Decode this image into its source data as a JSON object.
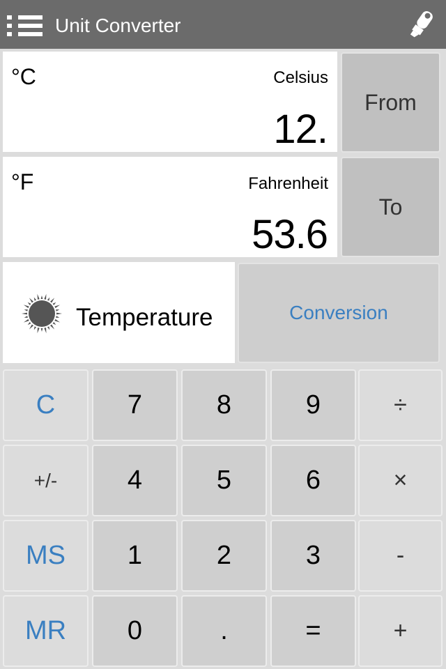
{
  "header": {
    "title": "Unit Converter",
    "menu_icon": "list-menu-icon",
    "action_icon": "marker-pen-icon"
  },
  "from_unit": {
    "symbol": "°C",
    "name": "Celsius",
    "value": "12.",
    "button_label": "From"
  },
  "to_unit": {
    "symbol": "°F",
    "name": "Fahrenheit",
    "value": "53.6",
    "button_label": "To"
  },
  "category": {
    "icon": "sun-icon",
    "label": "Temperature",
    "mode_button_label": "Conversion"
  },
  "keypad": {
    "rows": [
      [
        "C",
        "7",
        "8",
        "9",
        "÷"
      ],
      [
        "+/-",
        "4",
        "5",
        "6",
        "×"
      ],
      [
        "MS",
        "1",
        "2",
        "3",
        "-"
      ],
      [
        "MR",
        "0",
        ".",
        "=",
        "+"
      ]
    ]
  },
  "colors": {
    "header_bg": "#6b6b6b",
    "accent_blue": "#3a7fc1",
    "panel_bg": "#ffffff",
    "app_bg": "#dcdcdc"
  }
}
